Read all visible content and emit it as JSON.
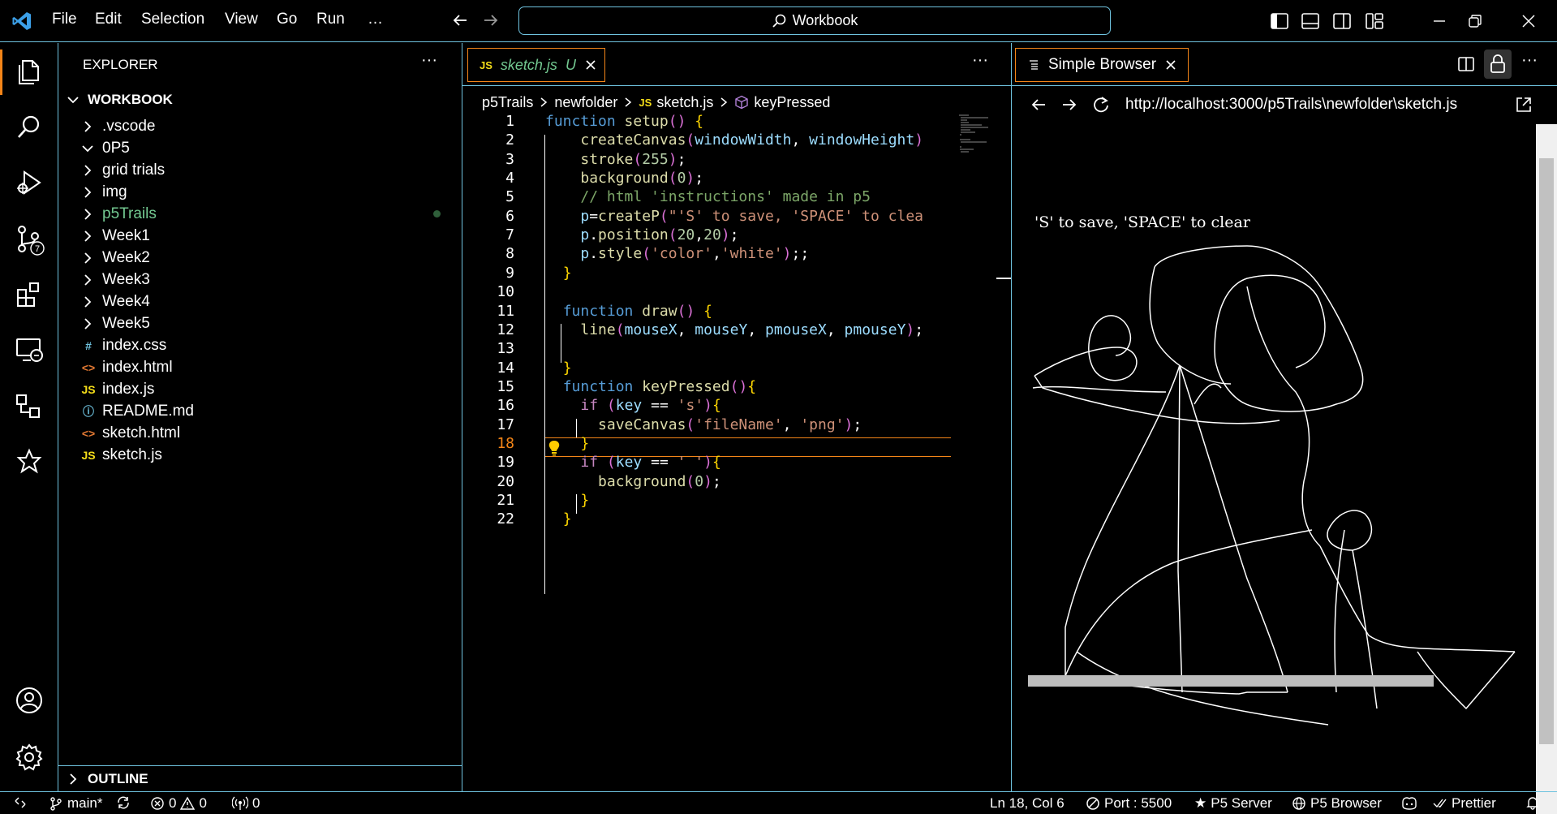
{
  "titlebar": {
    "menu": [
      "File",
      "Edit",
      "Selection",
      "View",
      "Go",
      "Run",
      "…"
    ],
    "search_text": "Workbook"
  },
  "sidebar": {
    "title": "EXPLORER",
    "root": "WORKBOOK",
    "items": [
      {
        "label": ".vscode",
        "kind": "folder",
        "expanded": false
      },
      {
        "label": "0P5",
        "kind": "folder",
        "expanded": true
      },
      {
        "label": "grid trials",
        "kind": "folder",
        "expanded": false
      },
      {
        "label": "img",
        "kind": "folder",
        "expanded": false
      },
      {
        "label": "p5Trails",
        "kind": "folder",
        "expanded": false,
        "modified": true
      },
      {
        "label": "Week1",
        "kind": "folder",
        "expanded": false
      },
      {
        "label": "Week2",
        "kind": "folder",
        "expanded": false
      },
      {
        "label": "Week3",
        "kind": "folder",
        "expanded": false
      },
      {
        "label": "Week4",
        "kind": "folder",
        "expanded": false
      },
      {
        "label": "Week5",
        "kind": "folder",
        "expanded": false
      },
      {
        "label": "index.css",
        "kind": "css"
      },
      {
        "label": "index.html",
        "kind": "html"
      },
      {
        "label": "index.js",
        "kind": "js"
      },
      {
        "label": "README.md",
        "kind": "md"
      },
      {
        "label": "sketch.html",
        "kind": "html"
      },
      {
        "label": "sketch.js",
        "kind": "js"
      }
    ],
    "outline": "OUTLINE"
  },
  "editor": {
    "tab_label": "sketch.js",
    "tab_status": "U",
    "tab_icon": "JS",
    "breadcrumb": [
      "p5Trails",
      "newfolder",
      "sketch.js",
      "keyPressed"
    ],
    "cursor_line": 18,
    "lines": [
      "function setup() {",
      "    createCanvas(windowWidth, windowHeight)",
      "    stroke(255);",
      "    background(0);",
      "    // html 'instructions' made in p5",
      "    p=createP(\"'S' to save, 'SPACE' to clea",
      "    p.position(20,20);",
      "    p.style('color','white');;",
      "  }",
      "",
      "  function draw() {",
      "    line(mouseX, mouseY, pmouseX, pmouseY);",
      "",
      "  }",
      "  function keyPressed(){",
      "    if (key == 's'){",
      "      saveCanvas('fileName', 'png');",
      "    }",
      "    if (key == ' '){",
      "      background(0);",
      "    }",
      "  }"
    ]
  },
  "browser": {
    "tab_label": "Simple Browser",
    "url": "http://localhost:3000/p5Trails\\newfolder\\sketch.js",
    "page_text": "'S' to save, 'SPACE' to clear"
  },
  "statusbar": {
    "branch": "main*",
    "errors": "0",
    "warnings": "0",
    "ports": "0",
    "position": "Ln 18, Col 6",
    "port": "Port : 5500",
    "p5server": "P5 Server",
    "p5browser": "P5 Browser",
    "prettier": "Prettier"
  },
  "colors": {
    "accent_border": "#6fc3df",
    "active_orange": "#f38518",
    "background": "#000000"
  }
}
